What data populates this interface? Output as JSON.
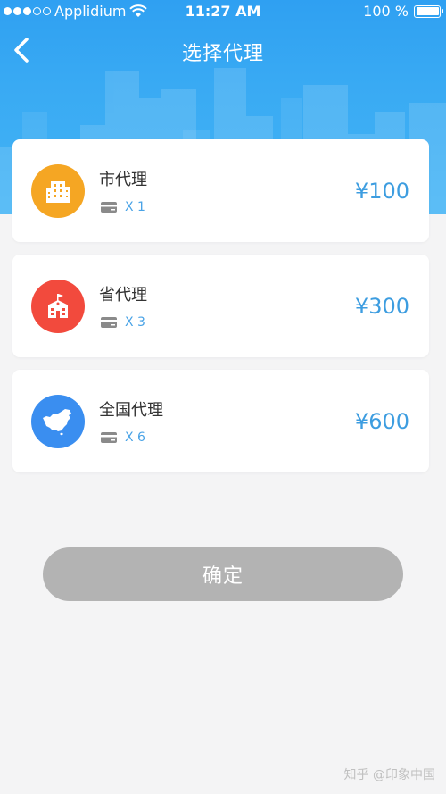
{
  "status_bar": {
    "carrier": "Applidium",
    "time": "11:27 AM",
    "battery": "100 %"
  },
  "nav": {
    "title": "选择代理",
    "back_icon": "chevron-left-icon"
  },
  "agents": [
    {
      "name": "市代理",
      "count": "X 1",
      "price": "¥100",
      "icon": "building-icon",
      "color": "#f5a623"
    },
    {
      "name": "省代理",
      "count": "X 3",
      "price": "¥300",
      "icon": "school-icon",
      "color": "#f24a3d"
    },
    {
      "name": "全国代理",
      "count": "X 6",
      "price": "¥600",
      "icon": "china-map-icon",
      "color": "#3a8ef0"
    }
  ],
  "confirm_label": "确定",
  "watermark": "知乎 @印象中国",
  "colors": {
    "header_blue": "#39aaf3",
    "price_blue": "#3d9de0",
    "button_gray": "#b3b3b3"
  }
}
